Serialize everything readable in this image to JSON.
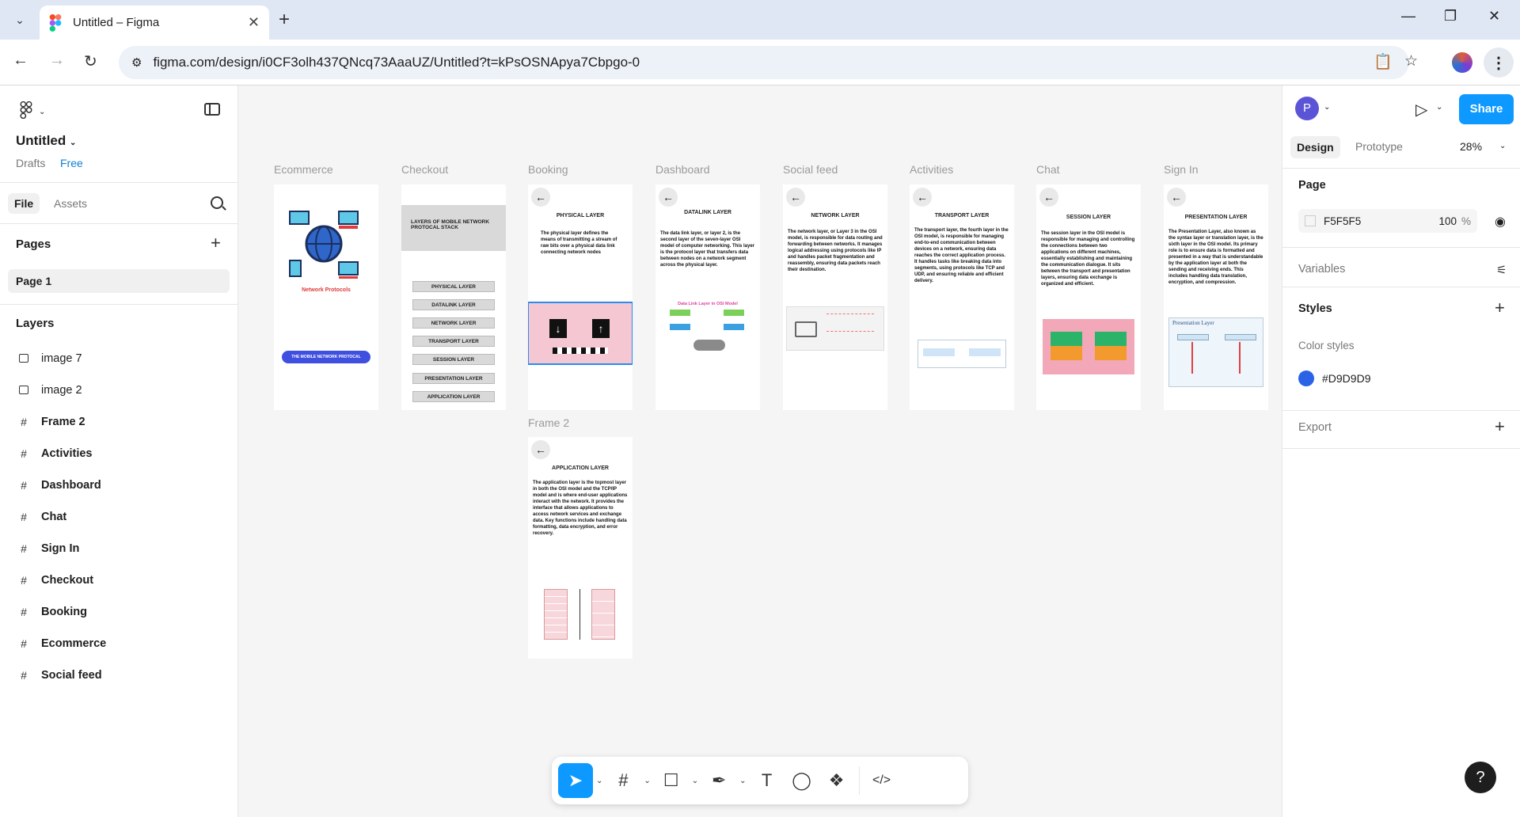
{
  "browser": {
    "tab_title": "Untitled – Figma",
    "url": "figma.com/design/i0CF3olh437QNcq73AaaUZ/Untitled?t=kPsOSNApya7Cbpgo-0"
  },
  "left_panel": {
    "file_name": "Untitled",
    "location": "Drafts",
    "plan": "Free",
    "tabs": [
      "File",
      "Assets"
    ],
    "pages_heading": "Pages",
    "pages": [
      "Page 1"
    ],
    "layers_heading": "Layers",
    "layers": [
      {
        "name": "image 7",
        "type": "image"
      },
      {
        "name": "image 2",
        "type": "image"
      },
      {
        "name": "Frame 2",
        "type": "frame"
      },
      {
        "name": "Activities",
        "type": "frame"
      },
      {
        "name": "Dashboard",
        "type": "frame"
      },
      {
        "name": "Chat",
        "type": "frame"
      },
      {
        "name": "Sign In",
        "type": "frame"
      },
      {
        "name": "Checkout",
        "type": "frame"
      },
      {
        "name": "Booking",
        "type": "frame"
      },
      {
        "name": "Ecommerce",
        "type": "frame"
      },
      {
        "name": "Social feed",
        "type": "frame"
      }
    ]
  },
  "canvas": {
    "frames": [
      {
        "label": "Ecommerce",
        "title": "Network Protocols",
        "button": "THE MOBILE NETWORK PROTOCAL"
      },
      {
        "label": "Checkout",
        "title": "LAYERS OF MOBILE NETWORK PROTOCAL STACK",
        "rows": [
          "PHYSICAL LAYER",
          "DATALINK LAYER",
          "NETWORK LAYER",
          "TRANSPORT LAYER",
          "SESSION LAYER",
          "PRESENTATION LAYER",
          "APPLICATION LAYER"
        ]
      },
      {
        "label": "Booking",
        "title": "PHYSICAL LAYER",
        "body": "The physical layer defines the means of transmitting a stream of raw bits over a physical data link connecting network nodes"
      },
      {
        "label": "Dashboard",
        "title": "DATALINK LAYER",
        "body": "The data link layer, or layer 2, is the second layer of the seven-layer OSI model of computer networking. This layer is the protocol layer that transfers data between nodes on a network segment across the physical layer.",
        "diagram_title": "Data Link Layer in OSI Model"
      },
      {
        "label": "Social feed",
        "title": "NETWORK LAYER",
        "body": "The network layer, or Layer 3 in the OSI model, is responsible for data routing and forwarding between networks. It manages logical addressing using protocols like IP and handles packet fragmentation and reassembly, ensuring data packets reach their destination."
      },
      {
        "label": "Activities",
        "title": "TRANSPORT LAYER",
        "body": "The transport layer, the fourth layer in the OSI model, is responsible for managing end-to-end communication between devices on a network, ensuring data reaches the correct application process. It handles tasks like breaking data into segments, using protocols like TCP and UDP, and ensuring reliable and efficient delivery."
      },
      {
        "label": "Chat",
        "title": "SESSION LAYER",
        "body": "The session layer in the OSI model is responsible for managing and controlling the connections between two applications on different machines, essentially establishing and maintaining the communication dialogue. It sits between the transport and presentation layers, ensuring data exchange is organized and efficient."
      },
      {
        "label": "Sign In",
        "title": "PRESENTATION LAYER",
        "body": "The Presentation Layer, also known as the syntax layer or translation layer, is the sixth layer in the OSI model. Its primary role is to ensure data is formatted and presented in a way that is understandable by the application layer at both the sending and receiving ends. This includes handling data translation, encryption, and compression.",
        "diagram_title": "Presentation Layer"
      },
      {
        "label": "Frame 2",
        "title": "APPLICATION LAYER",
        "body": "The application layer is the topmost layer in both the OSI model and the TCP/IP model and is where end-user applications interact with the network. It provides the interface that allows applications to access network services and exchange data. Key functions include handling data formatting, data encryption, and error recovery."
      }
    ]
  },
  "right_panel": {
    "user_initial": "P",
    "share_label": "Share",
    "tabs": [
      "Design",
      "Prototype"
    ],
    "zoom": "28%",
    "page_heading": "Page",
    "page_color": "F5F5F5",
    "page_opacity": "100",
    "opacity_unit": "%",
    "variables": "Variables",
    "styles": "Styles",
    "color_styles": "Color styles",
    "color_style_name": "#D9D9D9",
    "export": "Export",
    "colors": {
      "accent": "#0d99ff",
      "style_swatch": "#2b63e6"
    }
  },
  "toolbar": {
    "tools": [
      "move-tool",
      "frame-tool",
      "shape-tool",
      "pen-tool",
      "text-tool",
      "comment-tool",
      "actions-tool",
      "dev-mode-toggle"
    ]
  },
  "help": "?"
}
